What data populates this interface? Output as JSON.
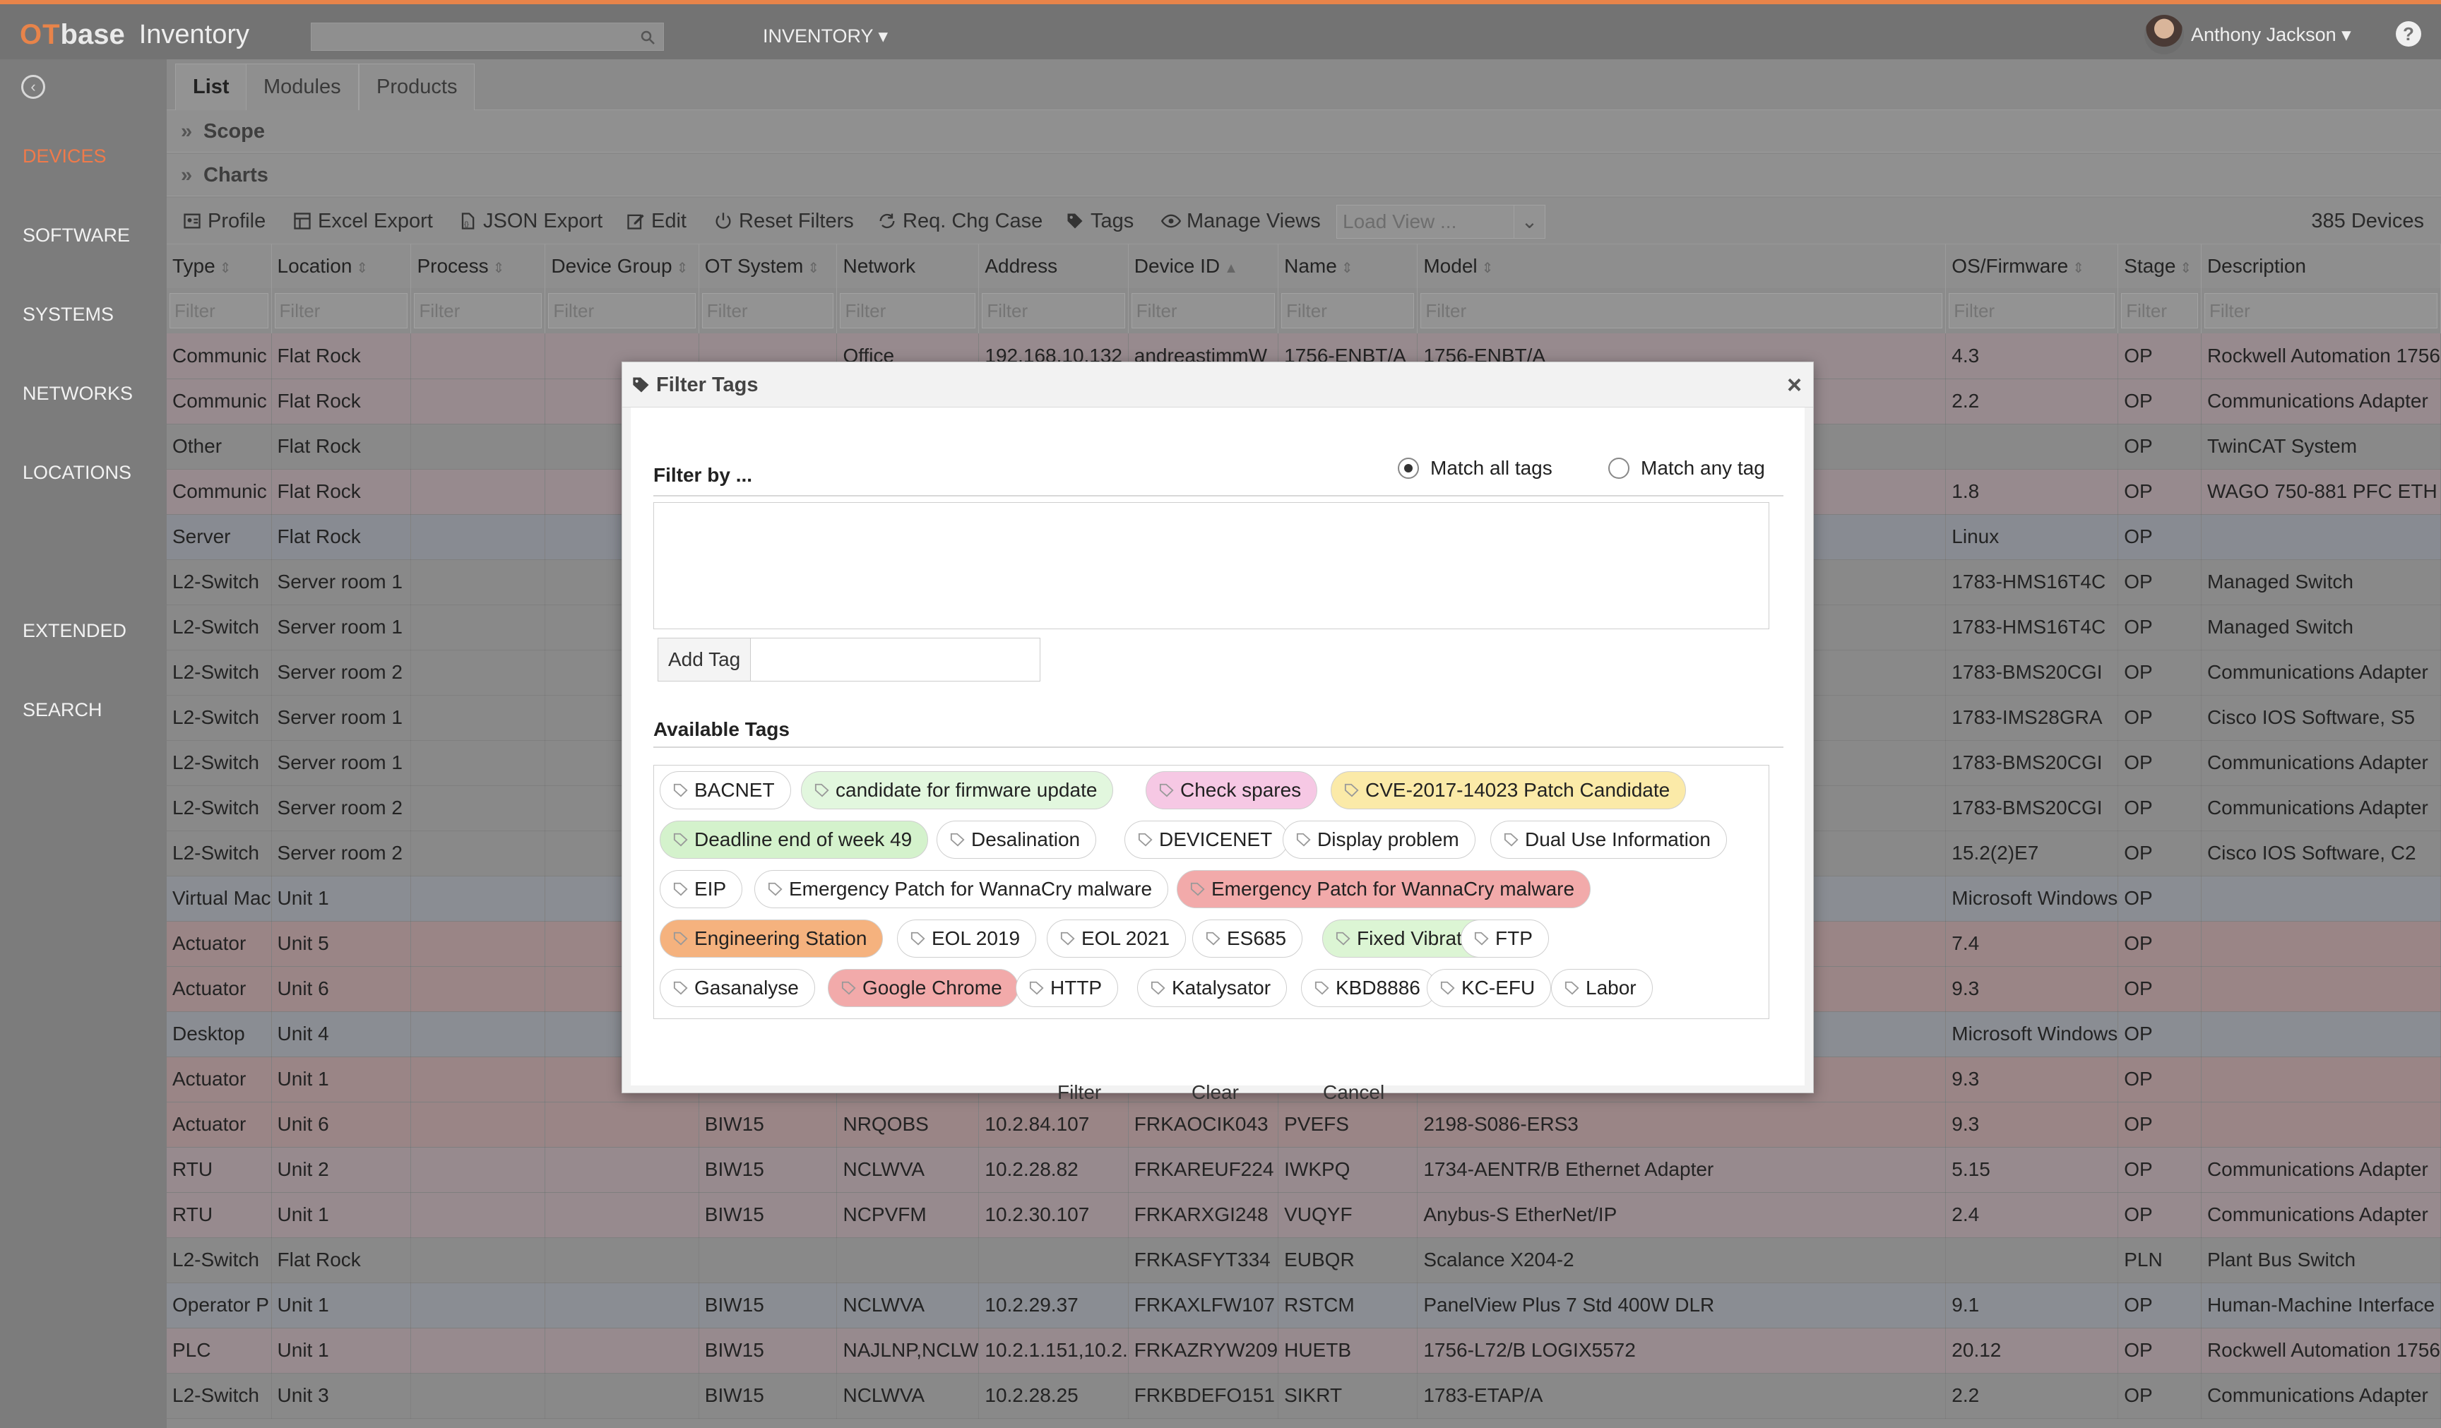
{
  "app": {
    "brand_ot": "OT",
    "brand_base": "base",
    "name": "Inventory",
    "menu": "INVENTORY ▾",
    "user": "Anthony Jackson ▾",
    "help": "?"
  },
  "sidebar": {
    "items": [
      "DEVICES",
      "SOFTWARE",
      "SYSTEMS",
      "NETWORKS",
      "LOCATIONS",
      "EXTENDED",
      "SEARCH"
    ],
    "active": "DEVICES"
  },
  "tabs": [
    "List",
    "Modules",
    "Products"
  ],
  "sections": {
    "scope": "Scope",
    "charts": "Charts"
  },
  "toolbar": {
    "profile": "Profile",
    "excel": "Excel Export",
    "json": "JSON Export",
    "edit": "Edit",
    "reset": "Reset Filters",
    "req": "Req. Chg Case",
    "tags": "Tags",
    "manage": "Manage Views",
    "load_view": "Load View ...",
    "count": "385 Devices"
  },
  "columns": [
    "Type",
    "Location",
    "Process",
    "Device Group",
    "OT System",
    "Network",
    "Address",
    "Device ID",
    "Name",
    "Model",
    "OS/Firmware",
    "Stage",
    "Description"
  ],
  "filter_placeholder": "Filter",
  "rows": [
    {
      "c": [
        "Communic",
        "Flat Rock",
        "",
        "",
        "",
        "Office",
        "192.168.10.132",
        "andreastimmW",
        "1756-ENBT/A",
        "1756-ENBT/A",
        "4.3",
        "OP",
        "Rockwell Automation 1756"
      ],
      "tone": "pink"
    },
    {
      "c": [
        "Communic",
        "Flat Rock",
        "",
        "",
        "",
        "",
        "",
        "",
        "",
        "",
        "2.2",
        "OP",
        "Communications Adapter"
      ],
      "tone": "pink"
    },
    {
      "c": [
        "Other",
        "Flat Rock",
        "",
        "",
        "",
        "",
        "",
        "",
        "",
        "",
        "",
        "OP",
        "TwinCAT System"
      ],
      "tone": "grey"
    },
    {
      "c": [
        "Communic",
        "Flat Rock",
        "",
        "",
        "",
        "",
        "",
        "",
        "",
        "",
        "1.8",
        "OP",
        "WAGO 750-881 PFC ETH"
      ],
      "tone": "pink"
    },
    {
      "c": [
        "Server",
        "Flat Rock",
        "",
        "",
        "",
        "",
        "",
        "",
        "",
        "",
        "Linux",
        "OP",
        ""
      ],
      "tone": "blue"
    },
    {
      "c": [
        "L2-Switch",
        "Server room 1",
        "",
        "",
        "",
        "",
        "",
        "",
        "",
        "",
        "1783-HMS16T4C",
        "OP",
        "Managed Switch"
      ],
      "tone": "grey"
    },
    {
      "c": [
        "L2-Switch",
        "Server room 1",
        "",
        "",
        "",
        "",
        "",
        "",
        "",
        "",
        "1783-HMS16T4C",
        "OP",
        "Managed Switch"
      ],
      "tone": "grey"
    },
    {
      "c": [
        "L2-Switch",
        "Server room 2",
        "",
        "",
        "",
        "",
        "",
        "",
        "",
        "",
        "1783-BMS20CGI",
        "OP",
        "Communications Adapter"
      ],
      "tone": "grey"
    },
    {
      "c": [
        "L2-Switch",
        "Server room 1",
        "",
        "",
        "",
        "",
        "",
        "",
        "",
        "",
        "1783-IMS28GRA",
        "OP",
        "Cisco IOS Software, S5"
      ],
      "tone": "grey"
    },
    {
      "c": [
        "L2-Switch",
        "Server room 1",
        "",
        "",
        "",
        "",
        "",
        "",
        "",
        "",
        "1783-BMS20CGI",
        "OP",
        "Communications Adapter"
      ],
      "tone": "grey"
    },
    {
      "c": [
        "L2-Switch",
        "Server room 2",
        "",
        "",
        "",
        "",
        "",
        "",
        "",
        "",
        "1783-BMS20CGI",
        "OP",
        "Communications Adapter"
      ],
      "tone": "grey"
    },
    {
      "c": [
        "L2-Switch",
        "Server room 2",
        "",
        "",
        "",
        "",
        "",
        "",
        "",
        "",
        "15.2(2)E7",
        "OP",
        "Cisco IOS Software, C2"
      ],
      "tone": "grey"
    },
    {
      "c": [
        "Virtual Mac",
        "Unit 1",
        "",
        "",
        "",
        "",
        "",
        "",
        "",
        "",
        "Microsoft Windows",
        "OP",
        ""
      ],
      "tone": "lblue"
    },
    {
      "c": [
        "Actuator",
        "Unit 5",
        "",
        "",
        "",
        "",
        "",
        "",
        "",
        "",
        "7.4",
        "OP",
        ""
      ],
      "tone": "red"
    },
    {
      "c": [
        "Actuator",
        "Unit 6",
        "",
        "",
        "",
        "",
        "",
        "",
        "",
        "",
        "9.3",
        "OP",
        ""
      ],
      "tone": "red"
    },
    {
      "c": [
        "Desktop",
        "Unit 4",
        "",
        "",
        "",
        "",
        "",
        "",
        "",
        "",
        "Microsoft Windows",
        "OP",
        ""
      ],
      "tone": "lblue"
    },
    {
      "c": [
        "Actuator",
        "Unit 1",
        "",
        "",
        "",
        "",
        "",
        "",
        "",
        "",
        "9.3",
        "OP",
        ""
      ],
      "tone": "red"
    },
    {
      "c": [
        "Actuator",
        "Unit 6",
        "",
        "",
        "BIW15",
        "NRQOBS",
        "10.2.84.107",
        "FRKAOCIK043",
        "PVEFS",
        "2198-S086-ERS3",
        "9.3",
        "OP",
        ""
      ],
      "tone": "red"
    },
    {
      "c": [
        "RTU",
        "Unit 2",
        "",
        "",
        "BIW15",
        "NCLWVA",
        "10.2.28.82",
        "FRKAREUF224",
        "IWKPQ",
        "1734-AENTR/B Ethernet Adapter",
        "5.15",
        "OP",
        "Communications Adapter"
      ],
      "tone": "pink"
    },
    {
      "c": [
        "RTU",
        "Unit 1",
        "",
        "",
        "BIW15",
        "NCPVFM",
        "10.2.30.107",
        "FRKARXGI248",
        "VUQYF",
        "Anybus-S EtherNet/IP",
        "2.4",
        "OP",
        "Communications Adapter"
      ],
      "tone": "pink"
    },
    {
      "c": [
        "L2-Switch",
        "Flat Rock",
        "",
        "",
        "",
        "",
        "",
        "FRKASFYT334",
        "EUBQR",
        "Scalance X204-2",
        "",
        "PLN",
        "Plant Bus Switch"
      ],
      "tone": "grey"
    },
    {
      "c": [
        "Operator P",
        "Unit 1",
        "",
        "",
        "BIW15",
        "NCLWVA",
        "10.2.29.37",
        "FRKAXLFW107",
        "RSTCM",
        "PanelView Plus 7 Std 400W DLR",
        "9.1",
        "OP",
        "Human-Machine Interface"
      ],
      "tone": "lblue"
    },
    {
      "c": [
        "PLC",
        "Unit 1",
        "",
        "",
        "BIW15",
        "NAJLNP,NCLW",
        "10.2.1.151,10.2.",
        "FRKAZRYW209",
        "HUETB",
        "1756-L72/B LOGIX5572",
        "20.12",
        "OP",
        "Rockwell Automation 1756"
      ],
      "tone": "pink"
    },
    {
      "c": [
        "L2-Switch",
        "Unit 3",
        "",
        "",
        "BIW15",
        "NCLWVA",
        "10.2.28.25",
        "FRKBDEFO151",
        "SIKRT",
        "1783-ETAP/A",
        "2.2",
        "OP",
        "Communications Adapter"
      ],
      "tone": "grey"
    }
  ],
  "modal": {
    "title": "Filter Tags",
    "close": "×",
    "filter_by": "Filter by ...",
    "match_all": "Match all tags",
    "match_any": "Match any tag",
    "add_tag": "Add Tag",
    "available": "Available Tags",
    "buttons": {
      "filter": "Filter",
      "clear": "Clear",
      "cancel": "Cancel"
    },
    "tags": [
      {
        "label": "BACNET",
        "color": "#ffffff"
      },
      {
        "label": "candidate for firmware update",
        "color": "#e2f7de"
      },
      {
        "label": "Check spares",
        "color": "#f6c8e4"
      },
      {
        "label": "CVE-2017-14023 Patch Candidate",
        "color": "#fbeaa8"
      },
      {
        "label": "Deadline end of week 49",
        "color": "#d4f2cc"
      },
      {
        "label": "Desalination",
        "color": "#ffffff"
      },
      {
        "label": "DEVICENET",
        "color": "#ffffff"
      },
      {
        "label": "Display problem",
        "color": "#ffffff"
      },
      {
        "label": "Dual Use Information",
        "color": "#ffffff"
      },
      {
        "label": "EIP",
        "color": "#ffffff"
      },
      {
        "label": "Emergency Patch for WannaCry malware",
        "color": "#ffffff"
      },
      {
        "label": "Emergency Patch for WannaCry malware",
        "color": "#f2aaaa"
      },
      {
        "label": "Engineering Station",
        "color": "#f5b27e"
      },
      {
        "label": "EOL 2019",
        "color": "#ffffff"
      },
      {
        "label": "EOL 2021",
        "color": "#ffffff"
      },
      {
        "label": "ES685",
        "color": "#ffffff"
      },
      {
        "label": "Fixed Vibration",
        "color": "#dcf5d4"
      },
      {
        "label": "FTP",
        "color": "#ffffff"
      },
      {
        "label": "Gasanalyse",
        "color": "#ffffff"
      },
      {
        "label": "Google Chrome",
        "color": "#f2aaaa"
      },
      {
        "label": "HTTP",
        "color": "#ffffff"
      },
      {
        "label": "Katalysator",
        "color": "#ffffff"
      },
      {
        "label": "KBD8886",
        "color": "#ffffff"
      },
      {
        "label": "KC-EFU",
        "color": "#ffffff"
      },
      {
        "label": "Labor",
        "color": "#ffffff"
      }
    ]
  }
}
